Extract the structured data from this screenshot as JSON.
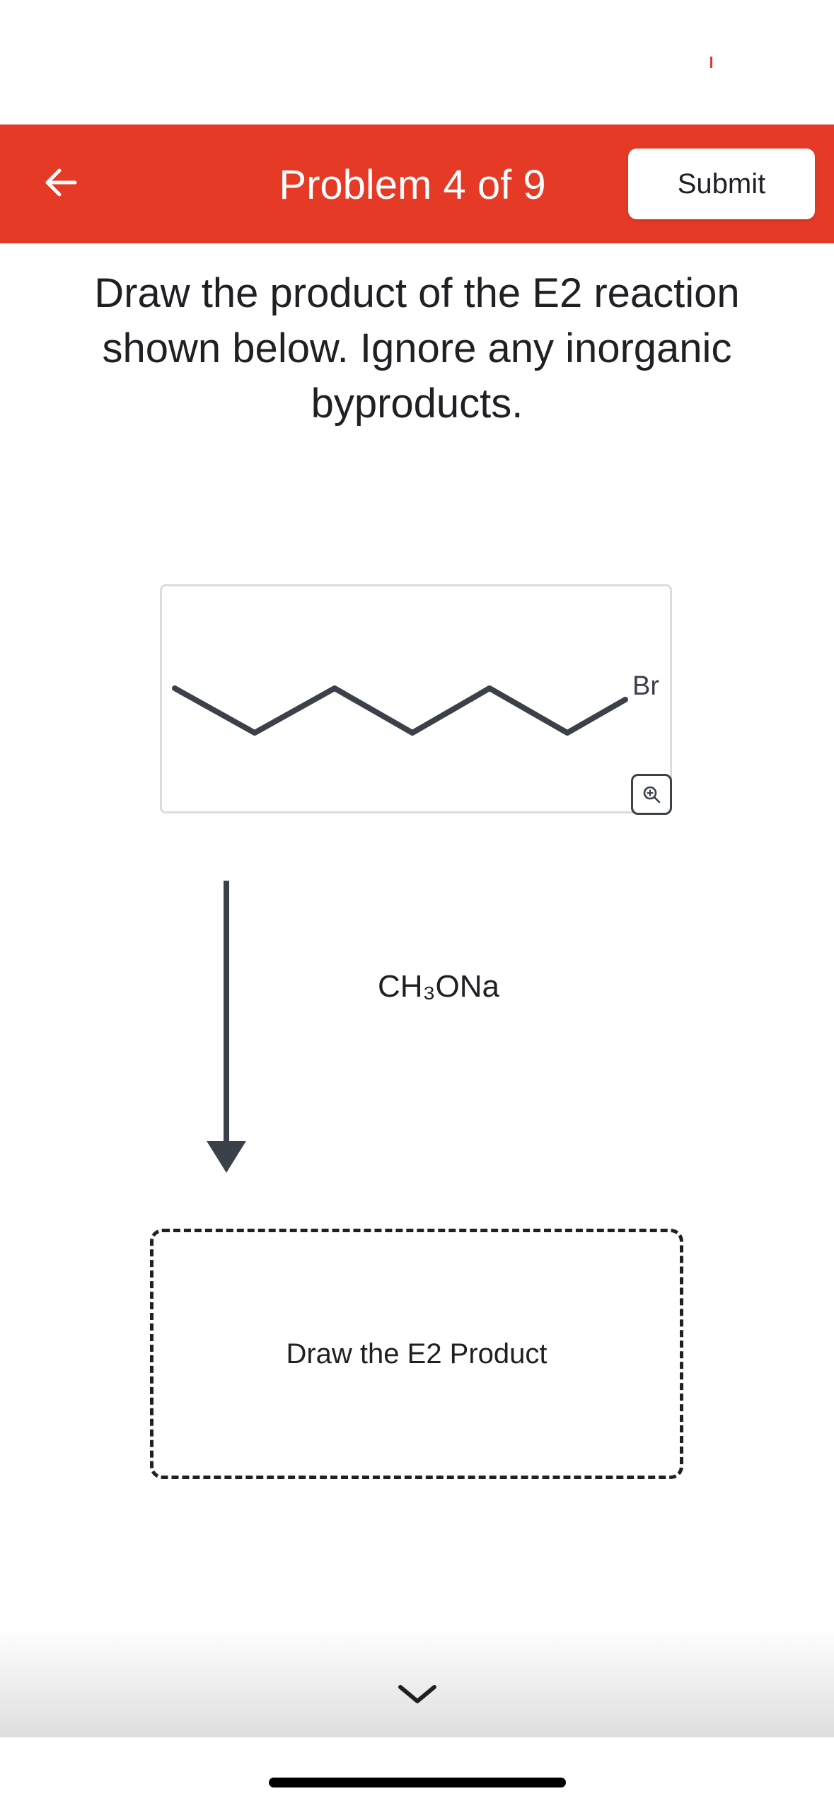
{
  "header": {
    "title": "Problem 4 of 9",
    "submit_label": "Submit",
    "background_color": "#e53a26",
    "back_icon": "arrow-left-icon"
  },
  "question": {
    "text": "Draw the product of the E2 reaction shown below. Ignore any inorganic byproducts."
  },
  "reactant": {
    "substituent_label": "Br",
    "zoom_icon": "zoom-in-icon"
  },
  "reaction": {
    "reagent": "CH₃ONa",
    "arrow_icon": "reaction-arrow-down-icon"
  },
  "answer": {
    "placeholder": "Draw the E2 Product"
  },
  "navigation": {
    "next_icon": "chevron-down-icon"
  }
}
